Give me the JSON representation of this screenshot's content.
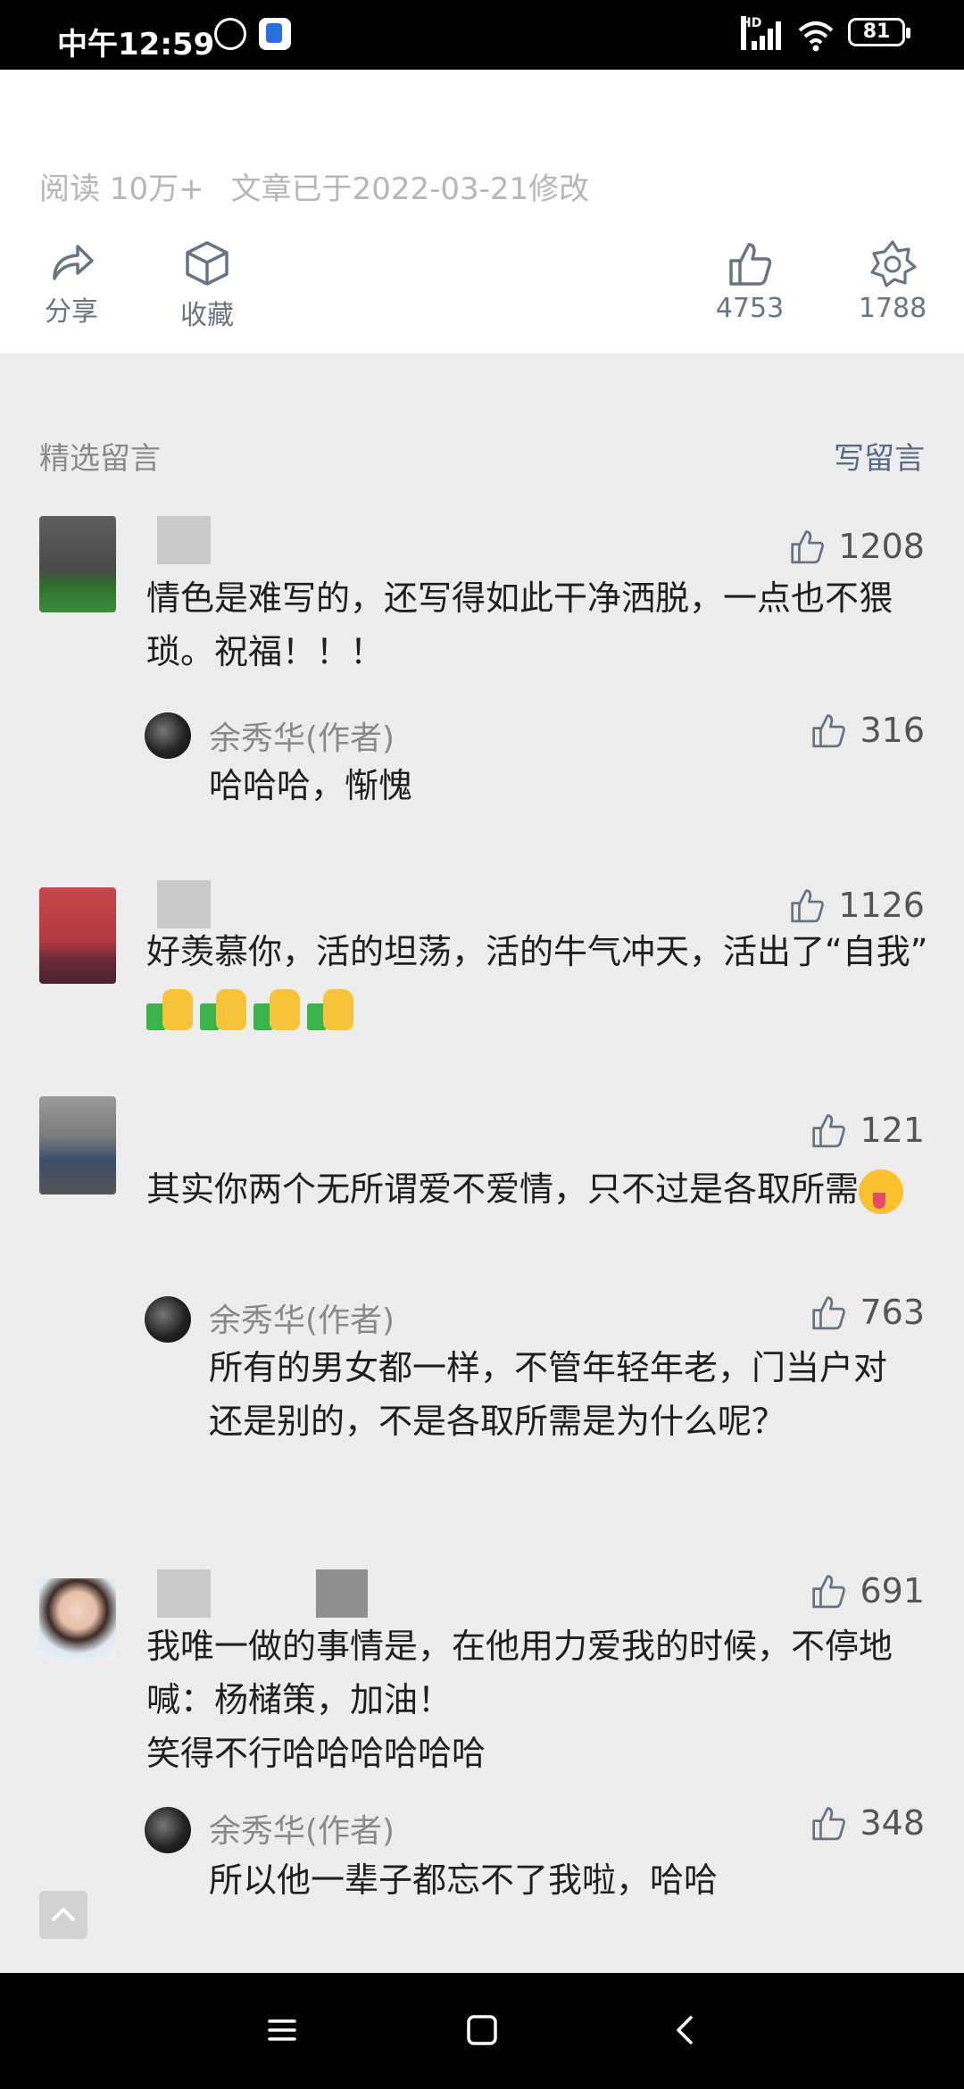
{
  "status_bar": {
    "time": "中午12:59",
    "network": "HD",
    "battery": "81",
    "icons": [
      "alarm-icon",
      "app-notification-icon",
      "signal-icon",
      "wifi-icon",
      "battery-icon"
    ]
  },
  "article": {
    "reads": "阅读 10万+",
    "modified": "文章已于2022-03-21修改",
    "actions": {
      "share": "分享",
      "collect": "收藏",
      "like_count": "4753",
      "wow_count": "1788"
    }
  },
  "comments_section": {
    "title": "精选留言",
    "write_label": "写留言",
    "comments": [
      {
        "text": "情色是难写的，还写得如此干净洒脱，一点也不猥琐。祝福！！！",
        "likes": "1208",
        "reply": {
          "name": "余秀华(作者)",
          "text": "哈哈哈，惭愧",
          "likes": "316"
        }
      },
      {
        "text": "好羡慕你，活的坦荡，活的牛气冲天，活出了“自我”",
        "likes": "1126"
      },
      {
        "text": "其实你两个无所谓爱不爱情，只不过是各取所需",
        "likes": "121",
        "reply": {
          "name": "余秀华(作者)",
          "text": "所有的男女都一样，不管年轻年老，门当户对还是别的，不是各取所需是为什么呢？",
          "likes": "763"
        }
      },
      {
        "text": "我唯一做的事情是，在他用力爱我的时候，不停地喊：杨槠策，加油！",
        "text_line2": "笑得不行哈哈哈哈哈哈",
        "likes": "691",
        "reply": {
          "name": "余秀华(作者)",
          "text": "所以他一辈子都忘不了我啦，哈哈",
          "likes": "348"
        }
      }
    ]
  },
  "colors": {
    "accent": "#586b86",
    "background": "#ededed",
    "muted": "#8b8b8b"
  }
}
